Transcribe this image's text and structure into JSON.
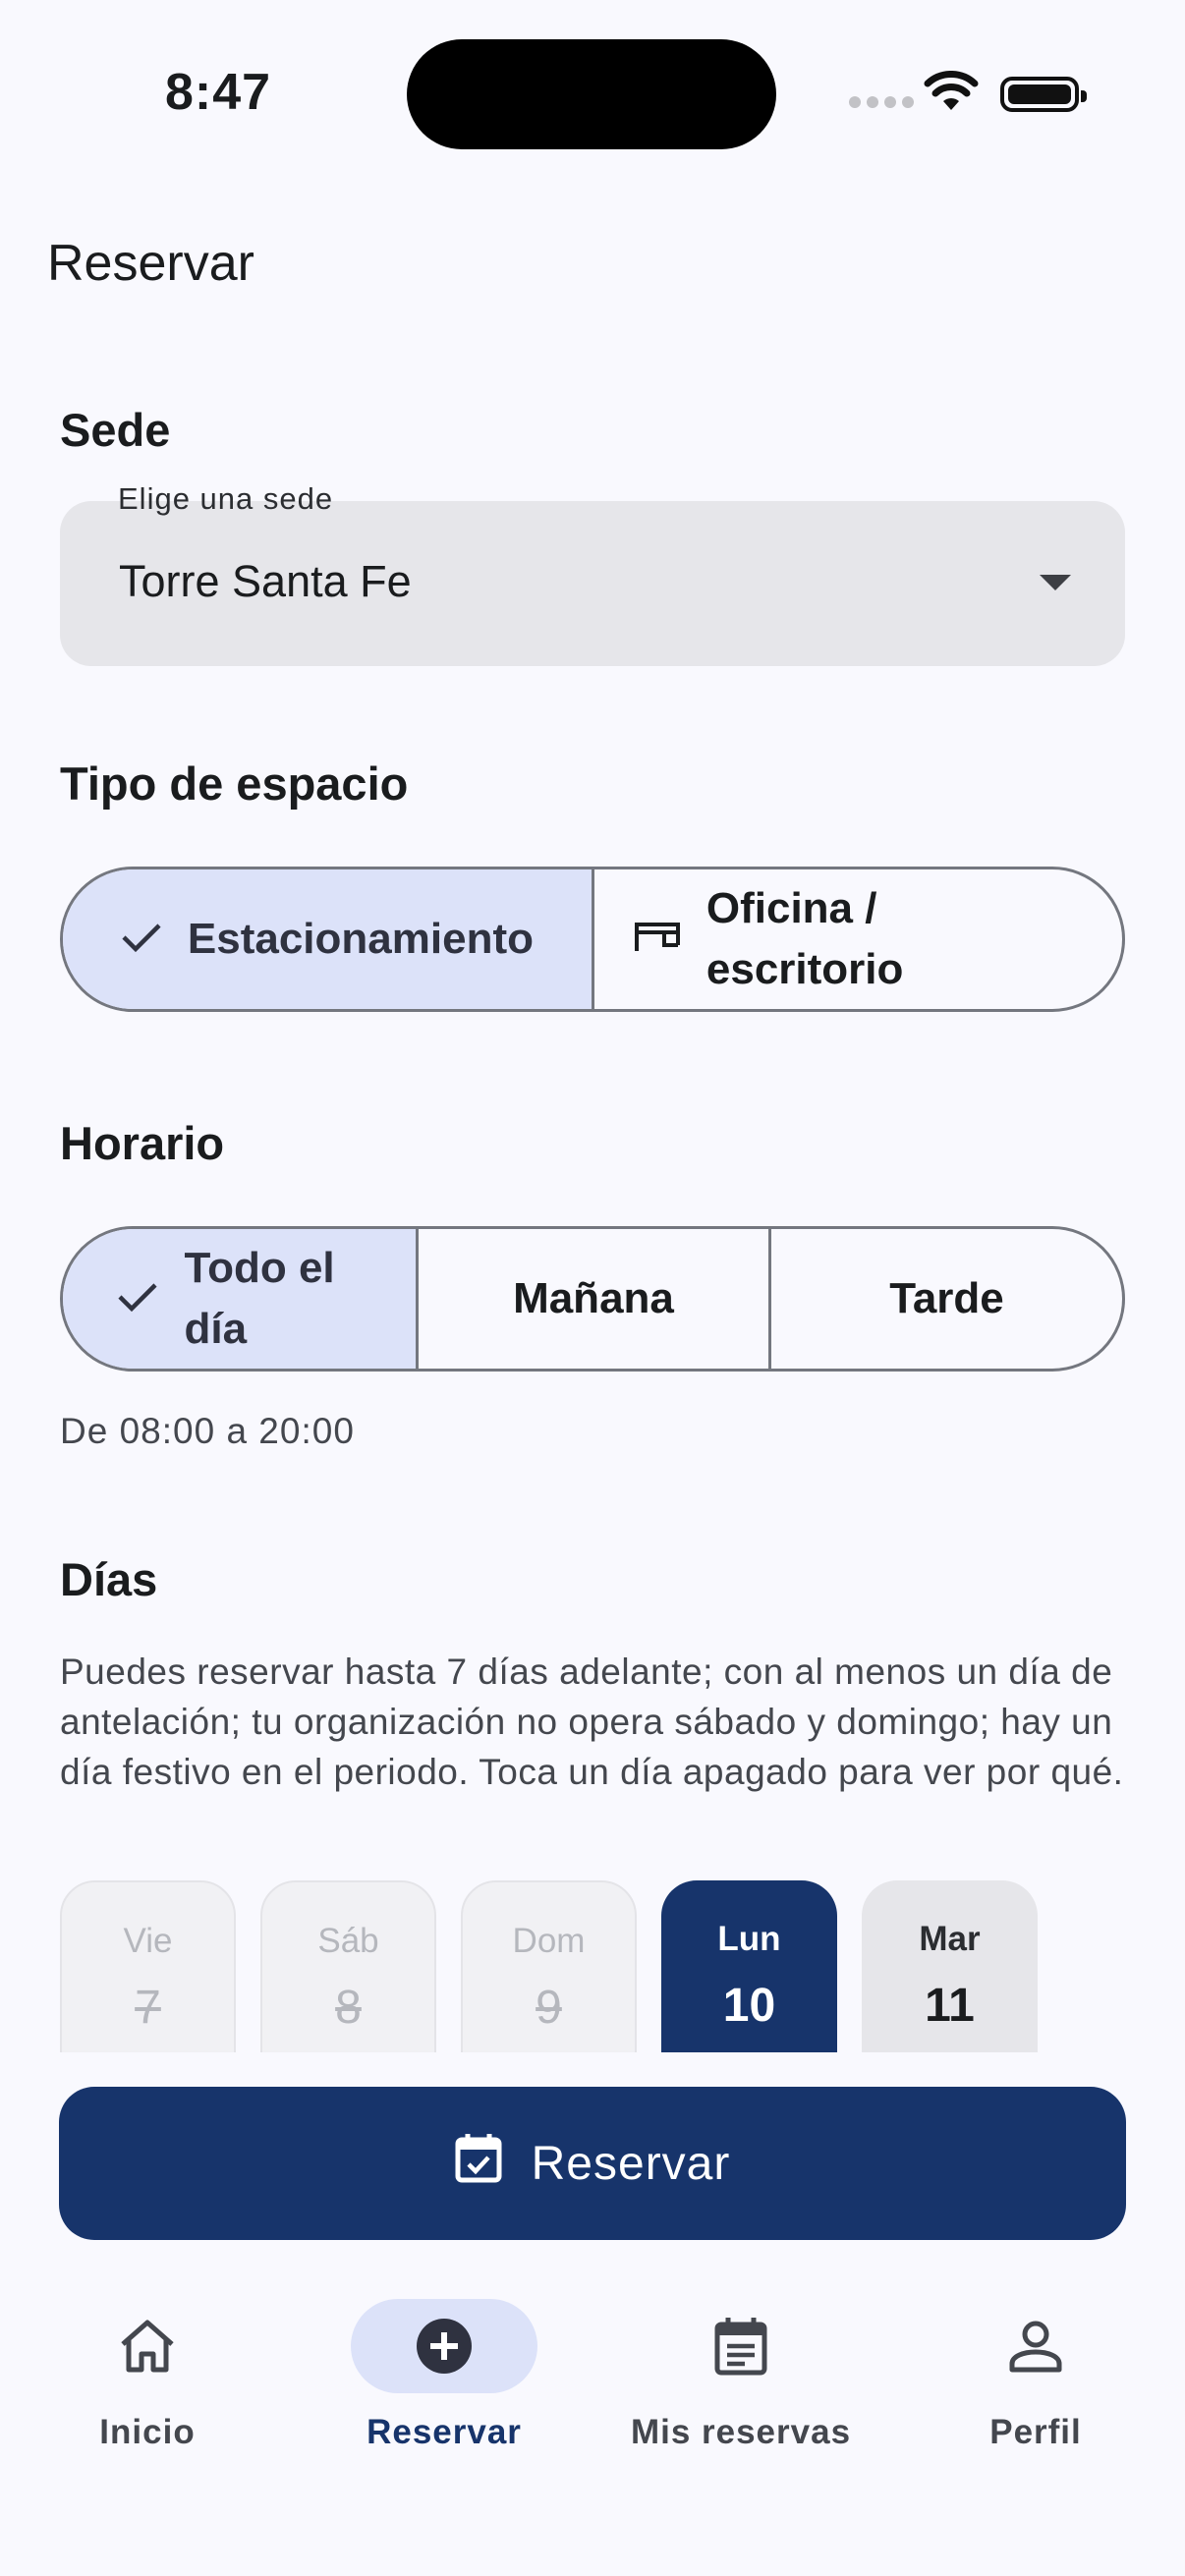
{
  "status_bar": {
    "time": "8:47"
  },
  "page": {
    "title": "Reservar"
  },
  "sede": {
    "section_title": "Sede",
    "field_label": "Elige una sede",
    "selected_value": "Torre Santa Fe"
  },
  "tipo": {
    "section_title": "Tipo de espacio",
    "options": [
      {
        "label": "Estacionamiento",
        "selected": true
      },
      {
        "label": "Oficina / escritorio",
        "selected": false
      }
    ]
  },
  "horario": {
    "section_title": "Horario",
    "options": [
      {
        "label": "Todo el día",
        "selected": true
      },
      {
        "label": "Mañana",
        "selected": false
      },
      {
        "label": "Tarde",
        "selected": false
      }
    ],
    "hint": "De 08:00 a 20:00"
  },
  "dias": {
    "section_title": "Días",
    "description": "Puedes reservar hasta 7 días adelante; con al menos un día de antelación; tu organización no opera sábado y domingo; hay un día festivo en el periodo. Toca un día apagado para ver por qué.",
    "days": [
      {
        "name": "Vie",
        "number": "7",
        "state": "disabled"
      },
      {
        "name": "Sáb",
        "number": "8",
        "state": "disabled"
      },
      {
        "name": "Dom",
        "number": "9",
        "state": "disabled"
      },
      {
        "name": "Lun",
        "number": "10",
        "state": "selected"
      },
      {
        "name": "Mar",
        "number": "11",
        "state": "enabled"
      }
    ]
  },
  "actions": {
    "reserve_label": "Reservar"
  },
  "bottom_nav": {
    "items": [
      {
        "label": "Inicio",
        "icon": "home-icon",
        "active": false
      },
      {
        "label": "Reservar",
        "icon": "add-circle-icon",
        "active": true
      },
      {
        "label": "Mis reservas",
        "icon": "calendar-list-icon",
        "active": false
      },
      {
        "label": "Perfil",
        "icon": "person-icon",
        "active": false
      }
    ]
  },
  "colors": {
    "primary": "#17346b",
    "selected_segment": "#dce2f9",
    "background": "#f9f9fe",
    "field_fill": "#e6e6ea"
  }
}
